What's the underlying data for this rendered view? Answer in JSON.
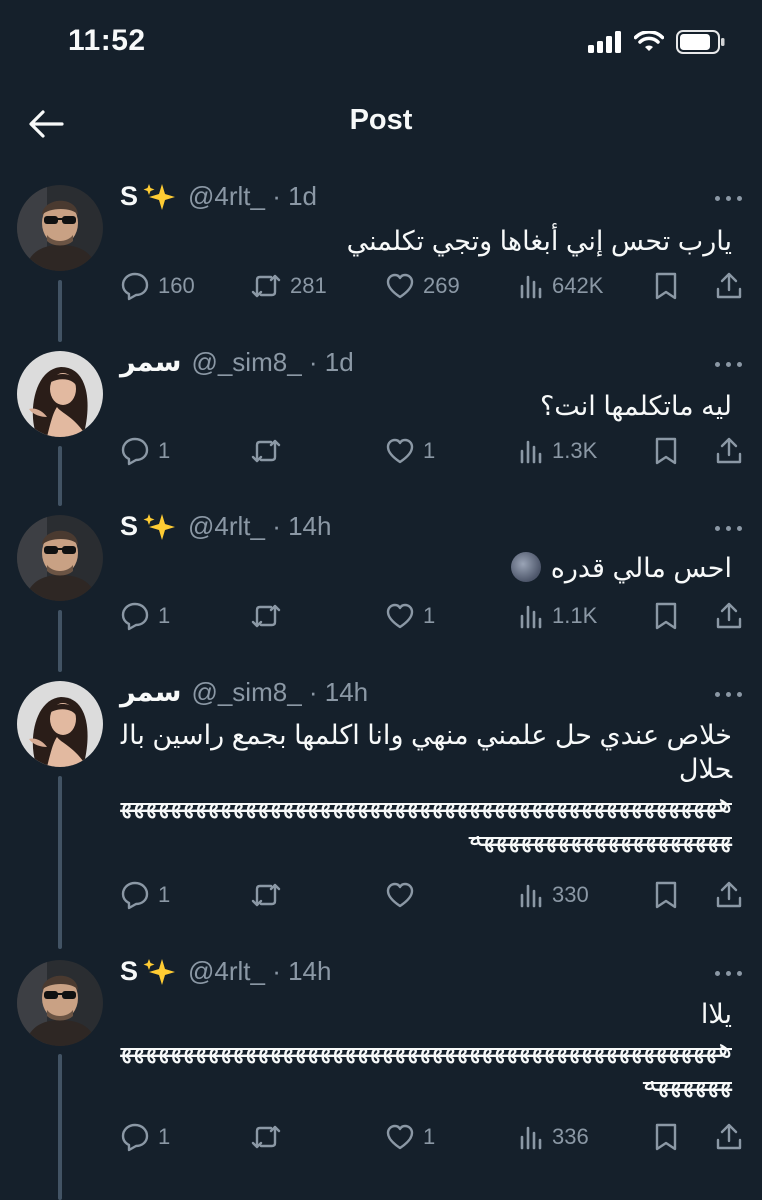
{
  "status_bar": {
    "time": "11:52"
  },
  "header": {
    "title": "Post"
  },
  "tweets": [
    {
      "name": "S",
      "handle": "@4rlt_ · 1d",
      "text": "يارب تحس إني أبغاها وتجي تكلمني",
      "replies": "160",
      "retweets": "281",
      "likes": "269",
      "views": "642K"
    },
    {
      "name": "سمر",
      "handle": "@_sim8_ · 1d",
      "text": "ليه ماتكلمها انت؟",
      "replies": "1",
      "retweets": "",
      "likes": "1",
      "views": "1.3K"
    },
    {
      "name": "S",
      "handle": "@4rlt_ · 14h",
      "text": "احس مالي قدره",
      "replies": "1",
      "retweets": "",
      "likes": "1",
      "views": "1.1K"
    },
    {
      "name": "سمر",
      "handle": "@_sim8_ · 14h",
      "text": "خلاص عندي حل علمني منهي وانا اكلمها بجمع راسين بالحلال",
      "laugh": "هههههههههههههههههههههههههههههههههههههههههههههههههههههههههههههههههههههه",
      "replies": "1",
      "retweets": "",
      "likes": "",
      "views": "330"
    },
    {
      "name": "S",
      "handle": "@4rlt_ · 14h",
      "text": "يلاا",
      "laugh": "هههههههههههههههههههههههههههههههههههههههههههههههههههههههه",
      "replies": "1",
      "retweets": "",
      "likes": "1",
      "views": "336"
    }
  ],
  "icons": {
    "reply": "speech-bubble-icon",
    "retweet": "retweet-icon",
    "like": "heart-icon",
    "views": "bar-chart-icon",
    "bookmark": "bookmark-icon",
    "share": "share-icon",
    "sparkle": "sparkles-emoji",
    "moon": "new-moon-face-emoji"
  },
  "colors": {
    "background": "#15202b",
    "text": "#f7f9f9",
    "secondary": "#8b98a5",
    "thread_line": "#425364"
  }
}
